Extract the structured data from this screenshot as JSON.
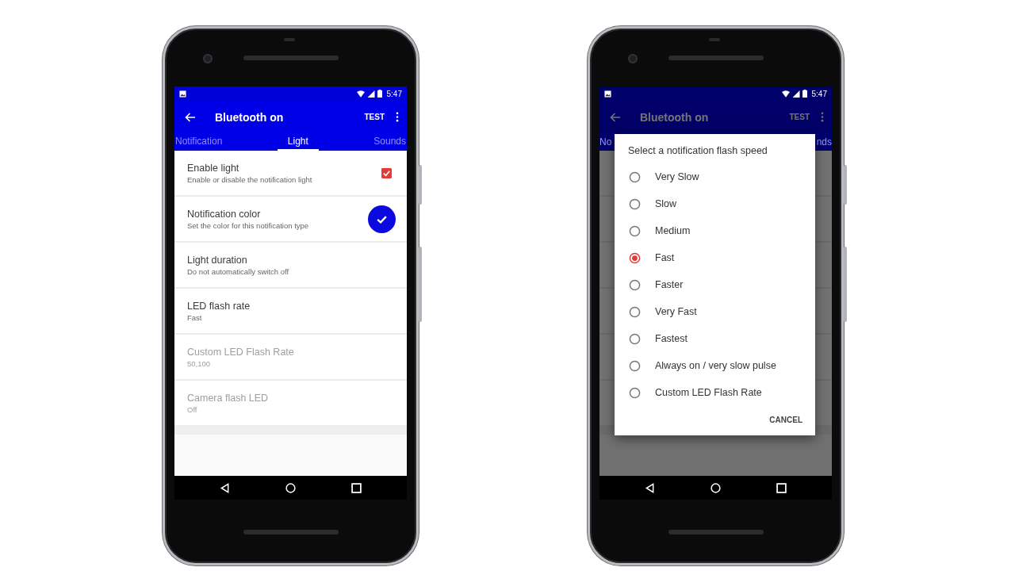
{
  "phones": [
    {
      "kind": "settings",
      "status_bar": {
        "time": "5:47"
      },
      "app_bar": {
        "title": "Bluetooth on",
        "action": "TEST"
      },
      "tabs": [
        {
          "label": "Notification",
          "selected": false
        },
        {
          "label": "Light",
          "selected": true
        },
        {
          "label": "Sounds",
          "selected": false
        }
      ],
      "settings": [
        {
          "kind": "checkbox",
          "title": "Enable light",
          "summary": "Enable or disable the notification light",
          "checked": true,
          "disabled": false
        },
        {
          "kind": "color",
          "title": "Notification color",
          "summary": "Set the color for this notification type",
          "color": "#0a0ae0",
          "disabled": false
        },
        {
          "kind": "text",
          "title": "Light duration",
          "summary": "Do not automatically switch off",
          "disabled": false
        },
        {
          "kind": "text",
          "title": "LED flash rate",
          "summary": "Fast",
          "disabled": false
        },
        {
          "kind": "text",
          "title": "Custom LED Flash Rate",
          "summary": "50,100",
          "disabled": true
        },
        {
          "kind": "text",
          "title": "Camera flash LED",
          "summary": "Off",
          "disabled": true
        }
      ]
    },
    {
      "kind": "dialog",
      "status_bar": {
        "time": "5:47"
      },
      "app_bar": {
        "title": "Bluetooth on",
        "action": "TEST"
      },
      "tab_fragments": [
        "No",
        "nds"
      ],
      "dialog": {
        "title": "Select a notification flash speed",
        "options": [
          {
            "label": "Very Slow",
            "selected": false
          },
          {
            "label": "Slow",
            "selected": false
          },
          {
            "label": "Medium",
            "selected": false
          },
          {
            "label": "Fast",
            "selected": true
          },
          {
            "label": "Faster",
            "selected": false
          },
          {
            "label": "Very Fast",
            "selected": false
          },
          {
            "label": "Fastest",
            "selected": false
          },
          {
            "label": "Always on / very slow pulse",
            "selected": false
          },
          {
            "label": "Custom LED Flash Rate",
            "selected": false
          }
        ],
        "button": "CANCEL"
      }
    }
  ]
}
